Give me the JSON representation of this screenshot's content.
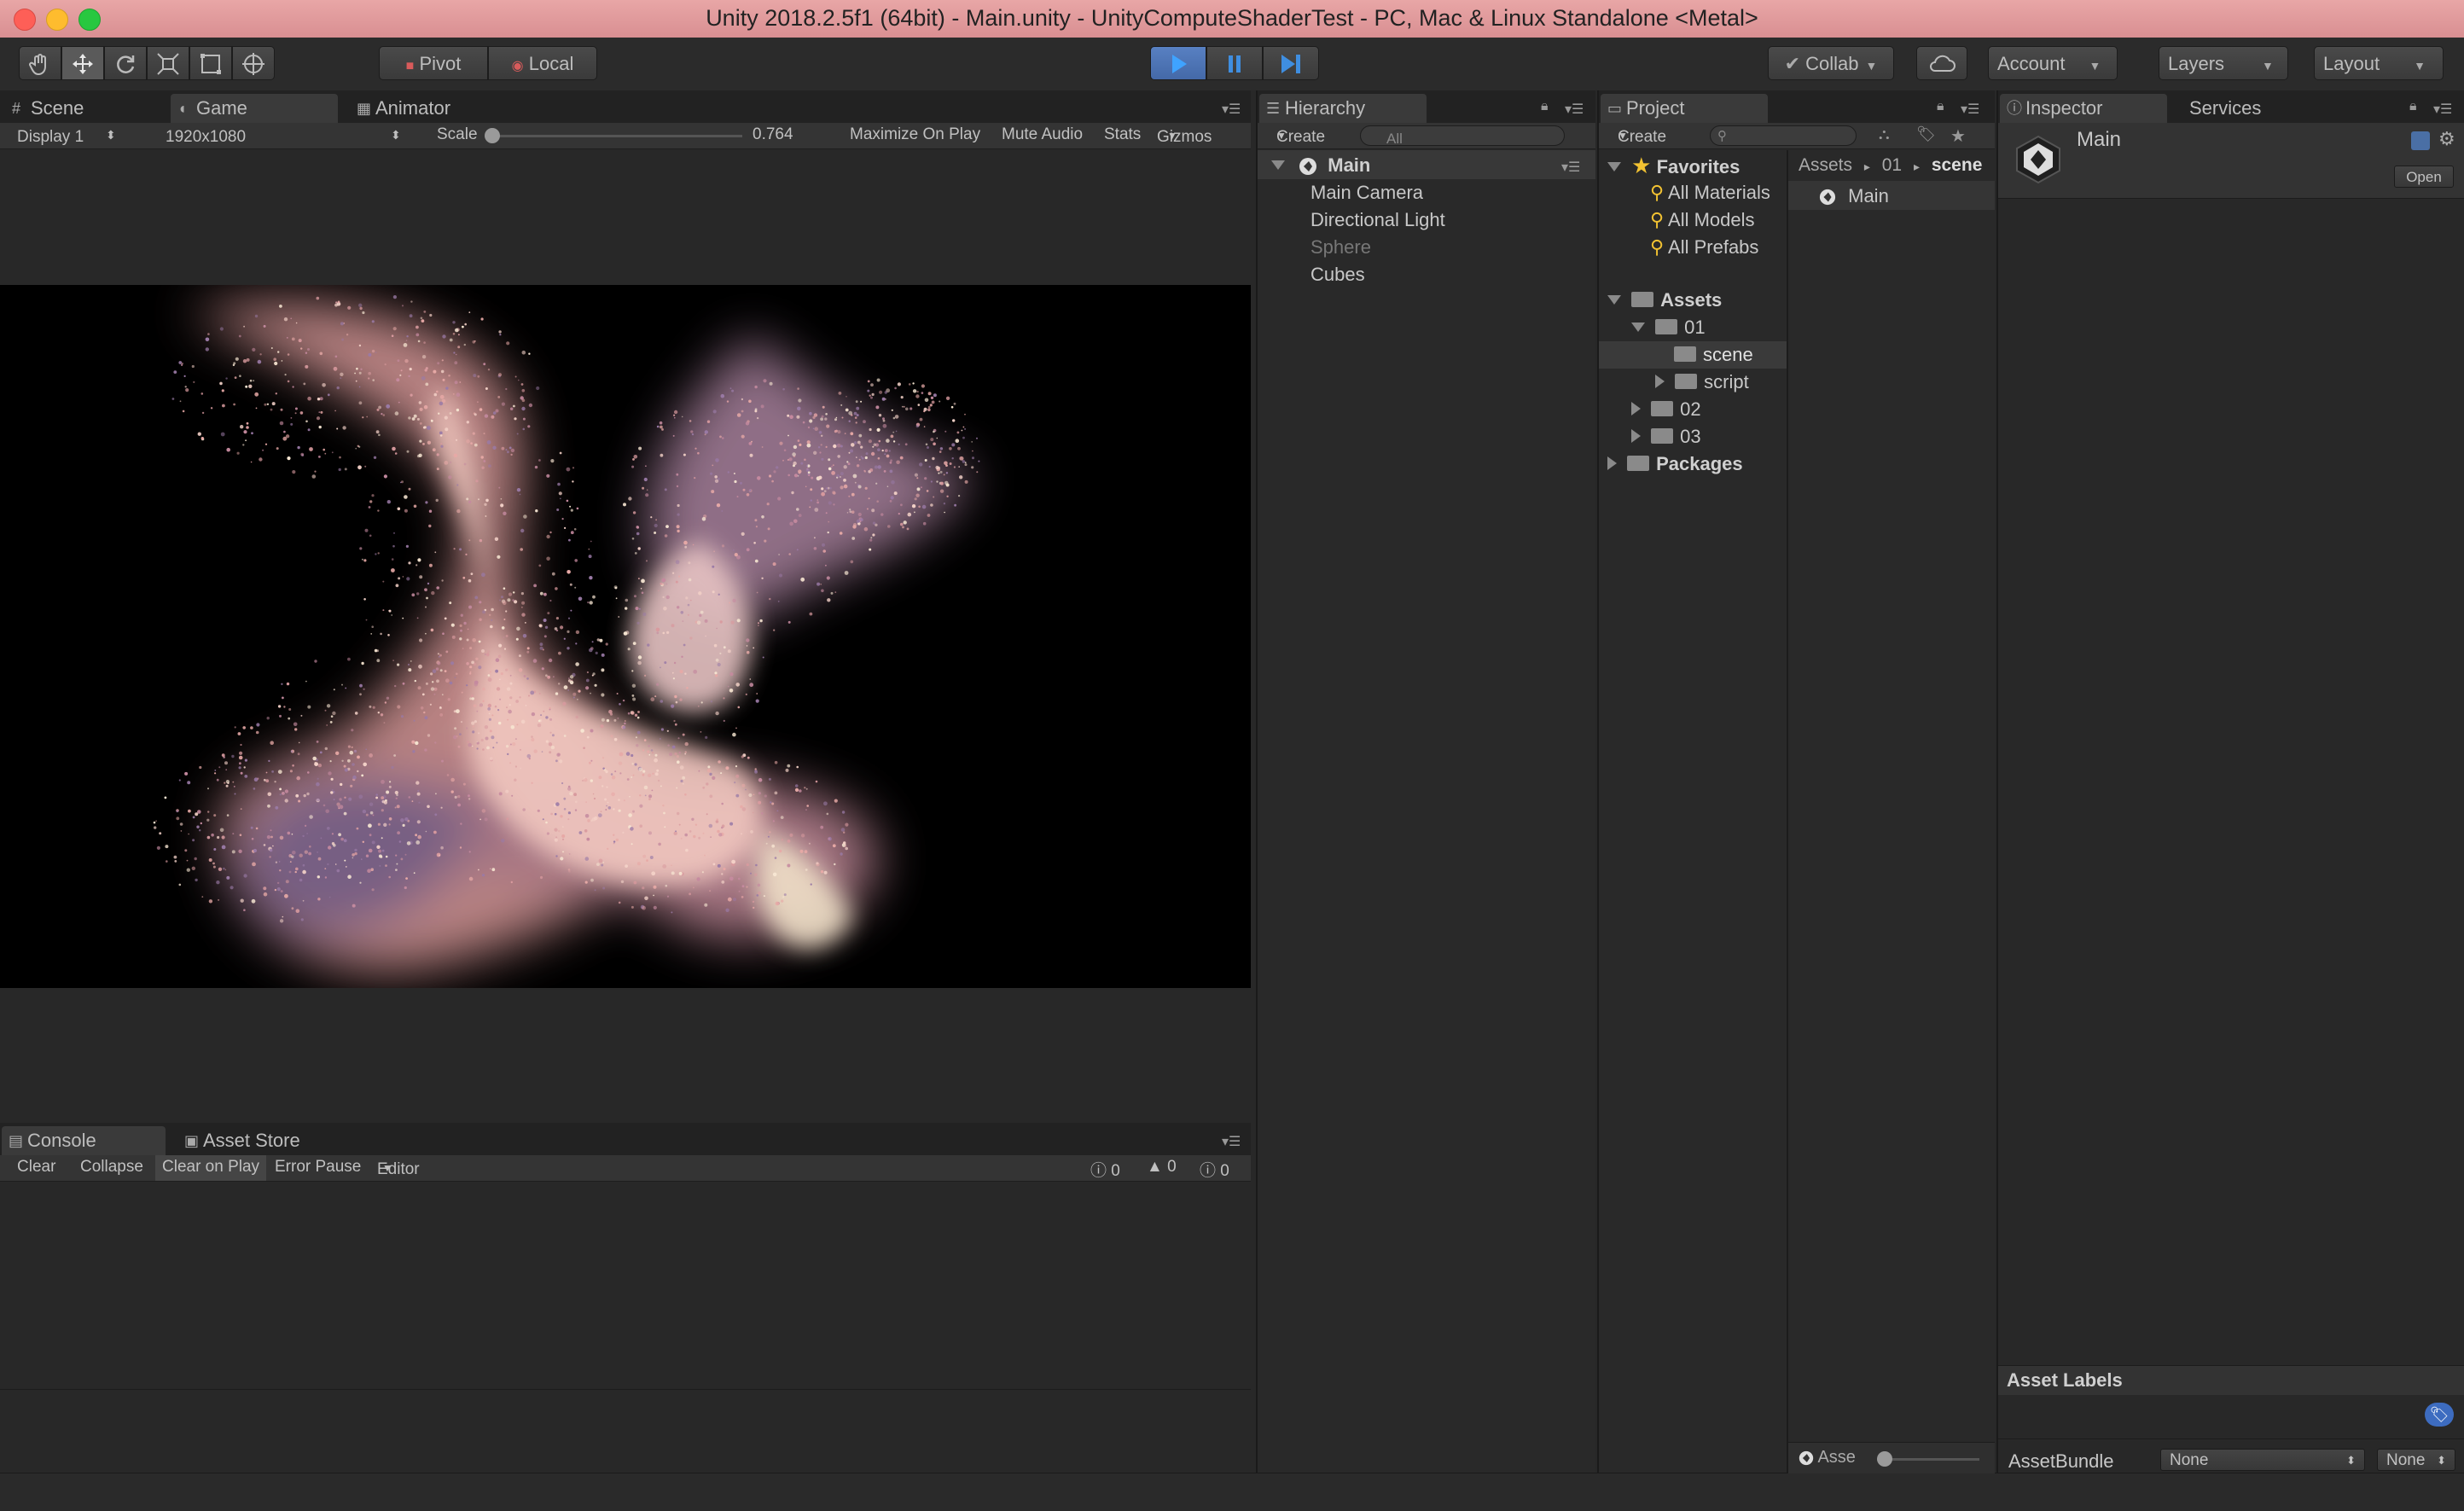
{
  "window": {
    "title": "Unity 2018.2.5f1 (64bit) - Main.unity - UnityComputeShaderTest - PC, Mac & Linux Standalone <Metal>"
  },
  "toolbar": {
    "tools": [
      "hand-tool",
      "move-tool",
      "rotate-tool",
      "scale-tool",
      "rect-tool",
      "transform-tool"
    ],
    "pivot_label": "Pivot",
    "local_label": "Local",
    "collab_label": "Collab",
    "account_label": "Account",
    "layers_label": "Layers",
    "layout_label": "Layout"
  },
  "game_panel": {
    "tabs": [
      "Scene",
      "Game",
      "Animator"
    ],
    "active_tab": "Game",
    "display": "Display 1",
    "resolution": "1920x1080",
    "scale_label": "Scale",
    "scale_value": "0.764",
    "maximize_on_play": "Maximize On Play",
    "mute_audio": "Mute Audio",
    "stats": "Stats",
    "gizmos": "Gizmos"
  },
  "console_panel": {
    "tabs": [
      "Console",
      "Asset Store"
    ],
    "clear": "Clear",
    "collapse": "Collapse",
    "clear_on_play": "Clear on Play",
    "error_pause": "Error Pause",
    "editor": "Editor",
    "info_count": "0",
    "warn_count": "0",
    "error_count": "0"
  },
  "hierarchy": {
    "tab": "Hierarchy",
    "create": "Create",
    "search_placeholder": "All",
    "scene_name": "Main",
    "items": [
      {
        "label": "Main Camera",
        "enabled": true
      },
      {
        "label": "Directional Light",
        "enabled": true
      },
      {
        "label": "Sphere",
        "enabled": false
      },
      {
        "label": "Cubes",
        "enabled": true
      }
    ]
  },
  "project": {
    "tab": "Project",
    "create": "Create",
    "favorites_label": "Favorites",
    "favorites": [
      "All Materials",
      "All Models",
      "All Prefabs"
    ],
    "assets_label": "Assets",
    "folders": {
      "f01": "01",
      "scene": "scene",
      "script": "script",
      "f02": "02",
      "f03": "03"
    },
    "packages_label": "Packages",
    "breadcrumb": [
      "Assets",
      "01",
      "scene"
    ],
    "files": [
      "Main"
    ],
    "footer_label": "Asse"
  },
  "inspector": {
    "tabs": [
      "Inspector",
      "Services"
    ],
    "object_name": "Main",
    "open_button": "Open",
    "asset_labels": "Asset Labels",
    "assetbundle_label": "AssetBundle",
    "assetbundle_value": "None",
    "assetbundle_variant": "None"
  },
  "colors": {
    "titlebar": "#dd9598",
    "play_accent": "#3f7fd9",
    "panel_bg": "#292929"
  }
}
